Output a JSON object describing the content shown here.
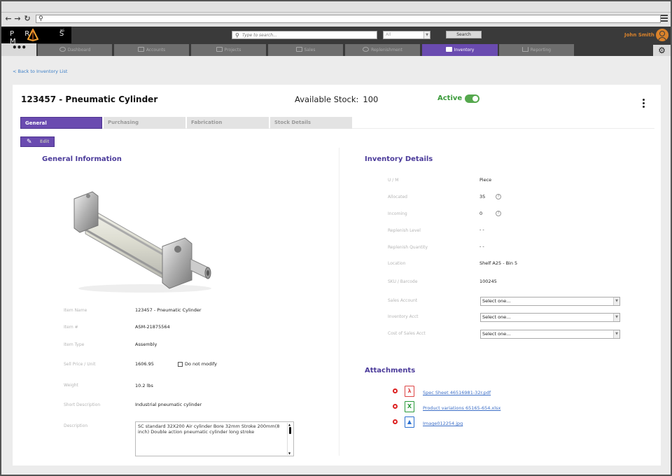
{
  "browser": {
    "url": ""
  },
  "app": {
    "logo_text": "PR SM",
    "logo_sup": "MS",
    "search_placeholder": "Type to search...",
    "scope_value": "All",
    "search_button": "Search",
    "user_name": "John Smith",
    "accent_color": "#6a4bb0",
    "user_color": "#d9822b"
  },
  "nav": {
    "menu_icon": "more-dots-icon",
    "tabs": [
      {
        "label": "Dashboard",
        "icon": "gauge-icon",
        "active": false
      },
      {
        "label": "Accounts",
        "icon": "book-icon",
        "active": false
      },
      {
        "label": "Projects",
        "icon": "folder-icon",
        "active": false
      },
      {
        "label": "Sales",
        "icon": "money-icon",
        "active": false
      },
      {
        "label": "Replenishment",
        "icon": "tools-icon",
        "active": false
      },
      {
        "label": "Inventory",
        "icon": "box-icon",
        "active": true
      },
      {
        "label": "Reporting",
        "icon": "bar-chart-icon",
        "active": false
      }
    ],
    "settings_icon": "gear-icon"
  },
  "page": {
    "back_link": "< Back to Inventory List",
    "title": "123457 - Pneumatic Cylinder",
    "available_stock_label": "Available Stock:",
    "available_stock_value": "100",
    "status_label": "Active",
    "status_on": true,
    "tabs": [
      "General",
      "Purchasing",
      "Fabrication",
      "Stock Details"
    ],
    "active_tab": "General",
    "edit_button": "Edit"
  },
  "general": {
    "title": "General Information",
    "image_alt": "Pneumatic cylinder product photo",
    "fields": [
      {
        "label": "Item Name",
        "value": "123457 - Pneumatic Cylinder"
      },
      {
        "label": "Item #",
        "value": "ASM-21875564"
      },
      {
        "label": "Item Type",
        "value": "Assembly"
      },
      {
        "label": "Sell Price / Unit",
        "value": "1606.95"
      },
      {
        "label": "Weight",
        "value": "10.2 lbs"
      },
      {
        "label": "Short Description",
        "value": "Industrial pneumatic cylinder"
      },
      {
        "label": "Description",
        "value": "SC standard 32X200 Air cylinder Bore 32mm Stroke 200mm(8 inch) Double action pneumatic cylinder long stroke"
      }
    ],
    "do_not_modify_label": "Do not modify",
    "do_not_modify_checked": false
  },
  "inventory": {
    "title": "Inventory Details",
    "fields": [
      {
        "label": "U / M",
        "value": "Piece"
      },
      {
        "label": "Allocated",
        "value": "35"
      },
      {
        "label": "Incoming",
        "value": "0"
      },
      {
        "label": "Replenish Level",
        "value": "- -"
      },
      {
        "label": "Replenish Quantity",
        "value": "- -"
      },
      {
        "label": "Location",
        "value": "Shelf A25 - Bin 5"
      },
      {
        "label": "SKU / Barcode",
        "value": "100245"
      }
    ],
    "selects": [
      {
        "label": "Sales Account",
        "value": "Select one..."
      },
      {
        "label": "Inventory Acct",
        "value": "Select one..."
      },
      {
        "label": "Cost of Sales Acct",
        "value": "Select one..."
      }
    ]
  },
  "attachments": {
    "title": "Attachments",
    "files": [
      {
        "name": "Spec Sheet 46516981-32r.pdf",
        "type": "pdf"
      },
      {
        "name": "Product variations 65165-654.xlsx",
        "type": "xlsx"
      },
      {
        "name": "Image012254.jpg",
        "type": "jpg"
      }
    ]
  }
}
